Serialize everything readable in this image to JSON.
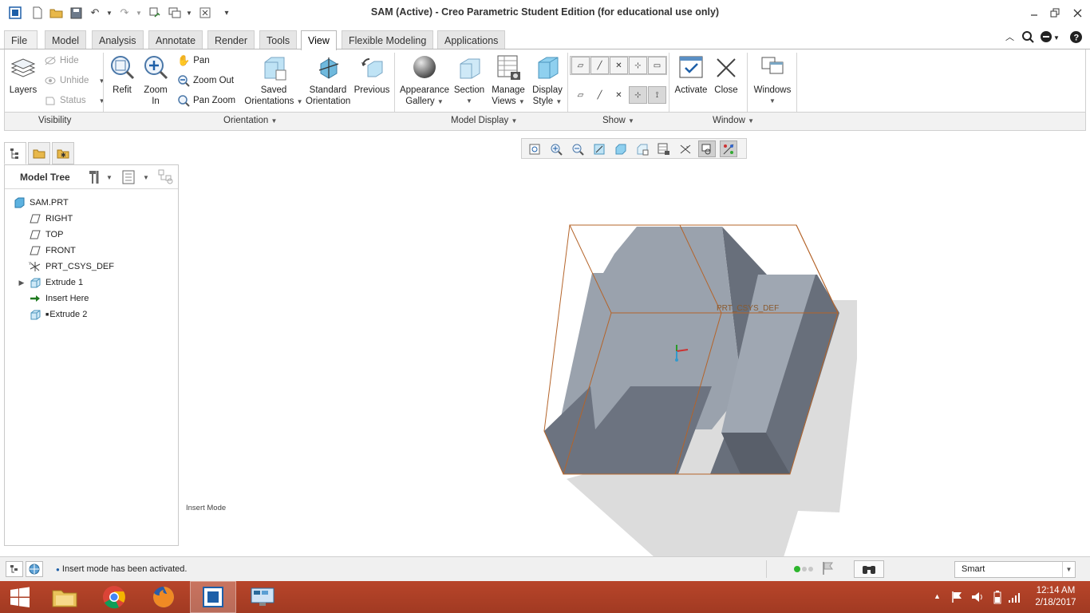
{
  "window": {
    "title": "SAM (Active) - Creo Parametric Student Edition (for educational use only)"
  },
  "tabs": [
    "File",
    "Model",
    "Analysis",
    "Annotate",
    "Render",
    "Tools",
    "View",
    "Flexible Modeling",
    "Applications"
  ],
  "active_tab": "View",
  "ribbon": {
    "visibility": {
      "layers": "Layers",
      "hide": "Hide",
      "unhide": "Unhide",
      "status": "Status",
      "group": "Visibility"
    },
    "orientation": {
      "refit": "Refit",
      "zoom_in": "Zoom In",
      "pan": "Pan",
      "zoom_out": "Zoom Out",
      "pan_zoom": "Pan Zoom",
      "saved_1": "Saved",
      "saved_2": "Orientations",
      "standard_1": "Standard",
      "standard_2": "Orientation",
      "previous": "Previous",
      "group": "Orientation"
    },
    "model_display": {
      "appearance_1": "Appearance",
      "appearance_2": "Gallery",
      "section": "Section",
      "manage_1": "Manage",
      "manage_2": "Views",
      "display_1": "Display",
      "display_2": "Style",
      "group": "Model Display"
    },
    "show": {
      "group": "Show"
    },
    "window": {
      "activate": "Activate",
      "close": "Close",
      "windows": "Windows",
      "group": "Window"
    }
  },
  "model_tree": {
    "header": "Model Tree",
    "items": [
      {
        "label": "SAM.PRT",
        "icon": "part-icon"
      },
      {
        "label": "RIGHT",
        "icon": "datum-plane-icon"
      },
      {
        "label": "TOP",
        "icon": "datum-plane-icon"
      },
      {
        "label": "FRONT",
        "icon": "datum-plane-icon"
      },
      {
        "label": "PRT_CSYS_DEF",
        "icon": "csys-icon"
      },
      {
        "label": "Extrude 1",
        "icon": "extrude-icon"
      },
      {
        "label": "Insert Here",
        "icon": "insert-arrow-icon"
      },
      {
        "label": "Extrude 2",
        "icon": "extrude-icon"
      }
    ]
  },
  "graphics": {
    "insert_mode": "Insert Mode",
    "csys_label": "PRT_CSYS_DEF"
  },
  "status": {
    "message": "Insert mode has been activated.",
    "filter": "Smart"
  },
  "taskbar": {
    "time": "12:14 AM",
    "date": "2/18/2017"
  },
  "colors": {
    "model_face": "#9aa3ae",
    "model_dark": "#6c7380",
    "edge": "#b4642a",
    "taskbar": "#a83d24"
  }
}
